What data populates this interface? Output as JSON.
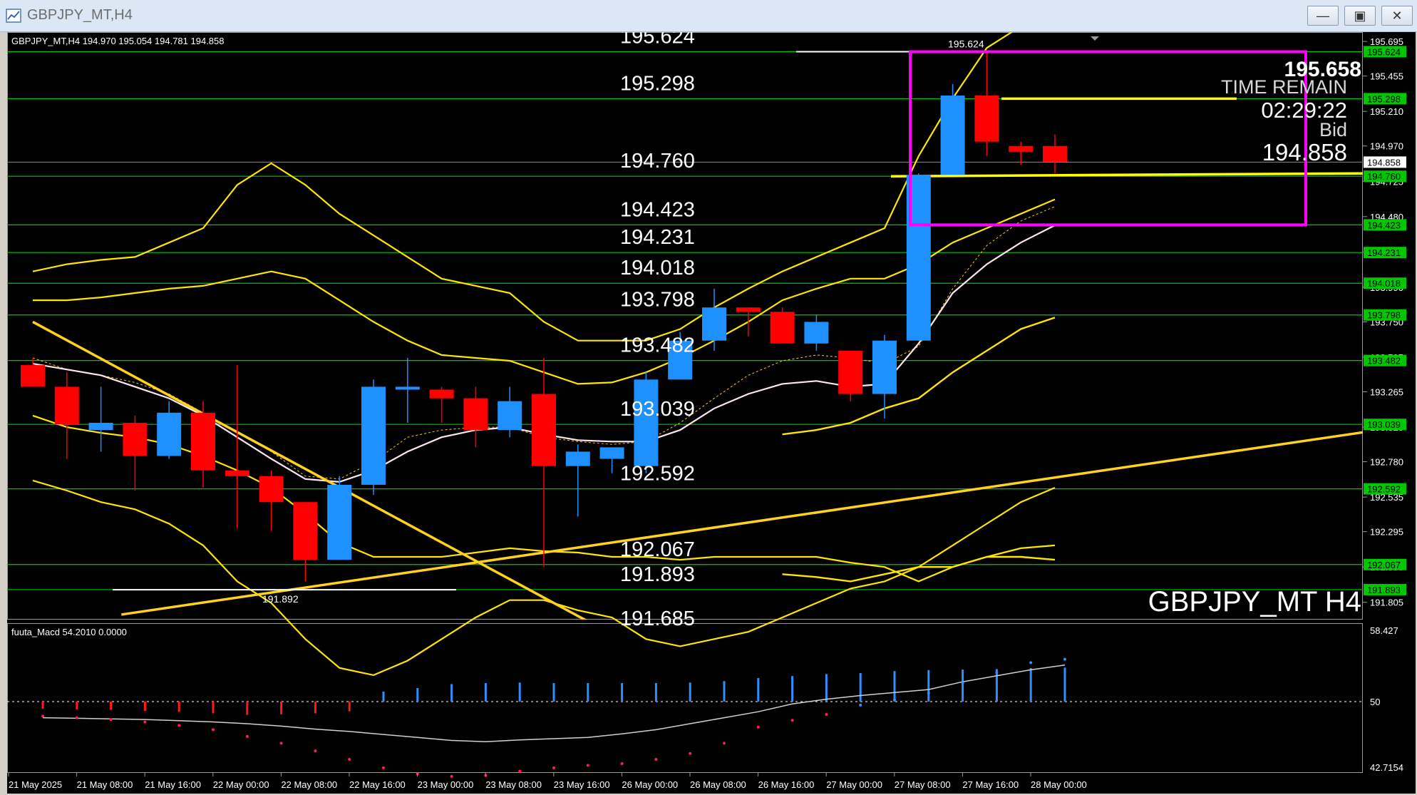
{
  "window": {
    "title": "GBPJPY_MT,H4",
    "buttons": [
      "minimize",
      "restore",
      "close"
    ],
    "colors": {
      "titlebar": "#dce7f5",
      "title_text": "#6d6d6d"
    }
  },
  "chart_header": "GBPJPY_MT,H4  194.970 195.054 194.781 194.858",
  "watermark": "GBPJPY_MT H4",
  "time_box": {
    "price_big": "195.658",
    "time_remain_label": "TIME REMAIN",
    "time_remain": "02:29:22",
    "bid_label": "Bid",
    "bid": "194.858"
  },
  "macd": {
    "label": "fuuta_Macd 54.2010  0.0000",
    "axis_labels": [
      "58.427",
      "50",
      "42.7154"
    ]
  },
  "colors": {
    "background": "#000000",
    "bull_candle": "#1e90ff",
    "bear_candle": "#ff0000",
    "level_line": "#00c800",
    "envelope": "#ffe600",
    "trendline": "#ffd21e",
    "box": "#ff00ff",
    "ma": "#ffe6ee"
  },
  "chart_data": {
    "type": "candlestick",
    "symbol": "GBPJPY_MT",
    "timeframe": "H4",
    "ylim": [
      191.685,
      195.76
    ],
    "y_ticks": [
      "195.695",
      "195.455",
      "195.210",
      "194.970",
      "194.725",
      "194.480",
      "194.235",
      "193.990",
      "193.750",
      "193.505",
      "193.265",
      "193.020",
      "192.780",
      "192.535",
      "192.295",
      "192.050",
      "191.805"
    ],
    "x_labels": [
      "21 May 2025",
      "21 May 08:00",
      "21 May 16:00",
      "22 May 00:00",
      "22 May 08:00",
      "22 May 16:00",
      "23 May 00:00",
      "23 May 08:00",
      "23 May 16:00",
      "26 May 00:00",
      "26 May 08:00",
      "26 May 16:00",
      "27 May 00:00",
      "27 May 08:00",
      "27 May 16:00",
      "28 May 00:00"
    ],
    "candles": [
      {
        "o": 193.45,
        "h": 193.5,
        "l": 193.3,
        "c": 193.3
      },
      {
        "o": 193.3,
        "h": 193.4,
        "l": 192.8,
        "c": 193.04
      },
      {
        "o": 193.0,
        "h": 193.3,
        "l": 192.85,
        "c": 193.05
      },
      {
        "o": 193.05,
        "h": 193.1,
        "l": 192.58,
        "c": 192.82
      },
      {
        "o": 192.82,
        "h": 193.2,
        "l": 192.8,
        "c": 193.12
      },
      {
        "o": 193.12,
        "h": 193.2,
        "l": 192.6,
        "c": 192.72
      },
      {
        "o": 192.72,
        "h": 193.45,
        "l": 192.32,
        "c": 192.68
      },
      {
        "o": 192.68,
        "h": 192.72,
        "l": 192.3,
        "c": 192.5
      },
      {
        "o": 192.5,
        "h": 192.5,
        "l": 191.95,
        "c": 192.1
      },
      {
        "o": 192.1,
        "h": 192.68,
        "l": 192.1,
        "c": 192.62
      },
      {
        "o": 192.62,
        "h": 193.35,
        "l": 192.55,
        "c": 193.3
      },
      {
        "o": 193.28,
        "h": 193.5,
        "l": 193.05,
        "c": 193.3
      },
      {
        "o": 193.28,
        "h": 193.3,
        "l": 193.05,
        "c": 193.22
      },
      {
        "o": 193.22,
        "h": 193.3,
        "l": 192.88,
        "c": 193.0
      },
      {
        "o": 193.0,
        "h": 193.3,
        "l": 192.95,
        "c": 193.2
      },
      {
        "o": 193.25,
        "h": 193.5,
        "l": 192.05,
        "c": 192.75
      },
      {
        "o": 192.75,
        "h": 192.9,
        "l": 192.4,
        "c": 192.85
      },
      {
        "o": 192.8,
        "h": 192.88,
        "l": 192.7,
        "c": 192.88
      },
      {
        "o": 192.75,
        "h": 193.4,
        "l": 192.7,
        "c": 193.35
      },
      {
        "o": 193.35,
        "h": 193.68,
        "l": 193.35,
        "c": 193.62
      },
      {
        "o": 193.62,
        "h": 193.98,
        "l": 193.55,
        "c": 193.85
      },
      {
        "o": 193.85,
        "h": 193.85,
        "l": 193.65,
        "c": 193.82
      },
      {
        "o": 193.82,
        "h": 193.85,
        "l": 193.6,
        "c": 193.6
      },
      {
        "o": 193.6,
        "h": 193.8,
        "l": 193.55,
        "c": 193.75
      },
      {
        "o": 193.55,
        "h": 193.55,
        "l": 193.2,
        "c": 193.25
      },
      {
        "o": 193.25,
        "h": 193.66,
        "l": 193.08,
        "c": 193.62
      },
      {
        "o": 193.62,
        "h": 194.78,
        "l": 193.62,
        "c": 194.77
      },
      {
        "o": 194.77,
        "h": 195.4,
        "l": 194.77,
        "c": 195.32
      },
      {
        "o": 195.32,
        "h": 195.62,
        "l": 194.9,
        "c": 195.0
      },
      {
        "o": 194.97,
        "h": 195.0,
        "l": 194.84,
        "c": 194.93
      },
      {
        "o": 194.97,
        "h": 195.05,
        "l": 194.78,
        "c": 194.86
      }
    ],
    "levels": [
      {
        "price": 195.624,
        "label": "195.624"
      },
      {
        "price": 195.298,
        "label": "195.298"
      },
      {
        "price": 194.76,
        "label": "194.760"
      },
      {
        "price": 194.423,
        "label": "194.423"
      },
      {
        "price": 194.231,
        "label": "194.231"
      },
      {
        "price": 194.018,
        "label": "194.018"
      },
      {
        "price": 193.798,
        "label": "193.798"
      },
      {
        "price": 193.482,
        "label": "193.482"
      },
      {
        "price": 193.039,
        "label": "193.039"
      },
      {
        "price": 192.592,
        "label": "192.592"
      },
      {
        "price": 192.067,
        "label": "192.067"
      },
      {
        "price": 191.893,
        "label": "191.893"
      }
    ],
    "current_price": {
      "price": 194.858,
      "label": "194.858"
    },
    "marker_labels": [
      {
        "text": "195.624",
        "price": 195.624
      },
      {
        "text": "191.892",
        "price": 191.892
      }
    ],
    "cutoff_label": "191.685",
    "bands": {
      "upper_outer": [
        194.1,
        194.15,
        194.18,
        194.2,
        194.3,
        194.4,
        194.7,
        194.85,
        194.7,
        194.5,
        194.35,
        194.2,
        194.05,
        194.0,
        193.95,
        193.75,
        193.62,
        193.62,
        193.62,
        193.7,
        193.85,
        193.98,
        194.1,
        194.2,
        194.3,
        194.4,
        194.9,
        195.3,
        195.65,
        195.8,
        195.95
      ],
      "upper_inner": [
        193.9,
        193.9,
        193.92,
        193.95,
        193.98,
        194.0,
        194.05,
        194.1,
        194.05,
        193.9,
        193.75,
        193.62,
        193.52,
        193.5,
        193.48,
        193.4,
        193.32,
        193.33,
        193.4,
        193.5,
        193.62,
        193.75,
        193.9,
        193.98,
        194.05,
        194.05,
        194.15,
        194.3,
        194.4,
        194.5,
        194.6
      ],
      "ma": [
        193.5,
        193.42,
        193.38,
        193.33,
        193.25,
        193.12,
        192.98,
        192.85,
        192.68,
        192.66,
        192.78,
        192.95,
        193.0,
        193.02,
        193.02,
        192.95,
        192.92,
        192.9,
        192.92,
        193.05,
        193.22,
        193.38,
        193.48,
        193.52,
        193.5,
        193.46,
        193.58,
        193.98,
        194.28,
        194.45,
        194.55
      ],
      "lower_inner": [
        193.1,
        193.02,
        192.98,
        192.95,
        192.9,
        192.82,
        192.72,
        192.6,
        192.42,
        192.22,
        192.12,
        192.12,
        192.12,
        192.15,
        192.18,
        192.16,
        192.15,
        192.12,
        192.12,
        192.1,
        192.12,
        192.12,
        192.12,
        192.12,
        192.08,
        192.05,
        191.95,
        192.05,
        192.12,
        192.18,
        192.2
      ],
      "lower_outer": [
        192.65,
        192.58,
        192.5,
        192.45,
        192.35,
        192.2,
        191.95,
        191.8,
        191.55,
        191.35,
        191.3,
        191.4,
        191.55,
        191.7,
        191.82,
        191.82,
        191.75,
        191.7,
        191.55,
        191.5,
        191.55,
        191.6,
        191.7,
        191.8,
        191.9,
        191.95,
        192.05,
        192.2,
        192.35,
        192.5,
        192.6
      ],
      "right_upper": [
        192.97,
        193.0,
        193.05,
        193.15,
        193.22,
        193.4,
        193.55,
        193.7,
        193.78
      ],
      "right_lower": [
        192.0,
        191.98,
        191.95,
        192.0,
        192.05,
        192.05,
        192.12,
        192.12,
        192.1
      ]
    },
    "trendlines": [
      {
        "from": {
          "i": 0,
          "price": 193.75
        },
        "to": {
          "i": 20,
          "price": 191.2
        },
        "label": "falling"
      },
      {
        "from": {
          "i": 2.6,
          "price": 191.72
        },
        "to": {
          "i": 39.5,
          "price": 193.0
        },
        "label": "rising"
      }
    ],
    "macd_hist": [
      -0.3,
      -0.35,
      -0.4,
      -0.5,
      -0.6,
      -0.75,
      -0.9,
      -0.85,
      -0.75,
      -0.55,
      0.15,
      0.5,
      0.9,
      1.0,
      1.05,
      1.0,
      1.0,
      1.0,
      1.0,
      1.05,
      1.2,
      1.5,
      1.7,
      1.9,
      2.0,
      2.2,
      2.3,
      2.35,
      2.4,
      2.5,
      2.55
    ],
    "macd_signal": [
      -1.5,
      -1.6,
      -1.7,
      -1.8,
      -2.0,
      -2.2,
      -2.5,
      -2.9,
      -3.4,
      -3.8,
      -4.3,
      -4.8,
      -5.3,
      -5.5,
      -5.2,
      -5.0,
      -4.8,
      -4.2,
      -3.5,
      -2.5,
      -1.5,
      -0.5,
      0.8,
      1.6,
      2.2,
      2.7,
      3.2,
      4.5,
      5.5,
      6.5,
      7.3
    ],
    "macd_dots": [
      -0.7,
      -0.9,
      -1.1,
      -1.4,
      -1.8,
      -2.3,
      -3.1,
      -3.9,
      -4.8,
      -5.8,
      -6.8,
      -7.5,
      -7.8,
      -7.7,
      -7.2,
      -6.8,
      -6.5,
      -6.3,
      -5.8,
      -5.1,
      -3.9,
      -2.0,
      -1.2,
      -0.5,
      0.6,
      1.2,
      2.0,
      3.2,
      4.4,
      5.6,
      6.0
    ],
    "macd_ylim": [
      42.7154,
      58.427
    ]
  }
}
